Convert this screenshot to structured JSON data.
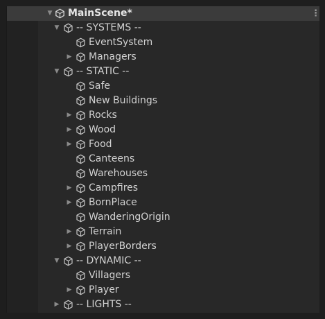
{
  "hierarchy": {
    "scene": {
      "label": "MainScene*",
      "icon": "unity-scene-icon",
      "expanded": true
    },
    "items": [
      {
        "label": "-- SYSTEMS --",
        "depth": 1,
        "arrow": "expanded"
      },
      {
        "label": "EventSystem",
        "depth": 2,
        "arrow": "none"
      },
      {
        "label": "Managers",
        "depth": 2,
        "arrow": "collapsed"
      },
      {
        "label": "-- STATIC --",
        "depth": 1,
        "arrow": "expanded"
      },
      {
        "label": "Safe",
        "depth": 2,
        "arrow": "none"
      },
      {
        "label": "New Buildings",
        "depth": 2,
        "arrow": "none"
      },
      {
        "label": "Rocks",
        "depth": 2,
        "arrow": "collapsed"
      },
      {
        "label": "Wood",
        "depth": 2,
        "arrow": "collapsed"
      },
      {
        "label": "Food",
        "depth": 2,
        "arrow": "collapsed"
      },
      {
        "label": "Canteens",
        "depth": 2,
        "arrow": "none"
      },
      {
        "label": "Warehouses",
        "depth": 2,
        "arrow": "none"
      },
      {
        "label": "Campfires",
        "depth": 2,
        "arrow": "collapsed"
      },
      {
        "label": "BornPlace",
        "depth": 2,
        "arrow": "collapsed"
      },
      {
        "label": "WanderingOrigin",
        "depth": 2,
        "arrow": "none"
      },
      {
        "label": "Terrain",
        "depth": 2,
        "arrow": "collapsed"
      },
      {
        "label": "PlayerBorders",
        "depth": 2,
        "arrow": "collapsed"
      },
      {
        "label": "-- DYNAMIC --",
        "depth": 1,
        "arrow": "expanded"
      },
      {
        "label": "Villagers",
        "depth": 2,
        "arrow": "none"
      },
      {
        "label": "Player",
        "depth": 2,
        "arrow": "collapsed"
      },
      {
        "label": "-- LIGHTS --",
        "depth": 1,
        "arrow": "collapsed"
      }
    ],
    "item_icon": "gameobject-cube-icon",
    "menu_icon": "kebab-menu-icon"
  },
  "colors": {
    "panel": "#282828",
    "scene_row": "#3b3b3b",
    "text": "#d2d2d2",
    "icon": "#c4c4c4"
  }
}
